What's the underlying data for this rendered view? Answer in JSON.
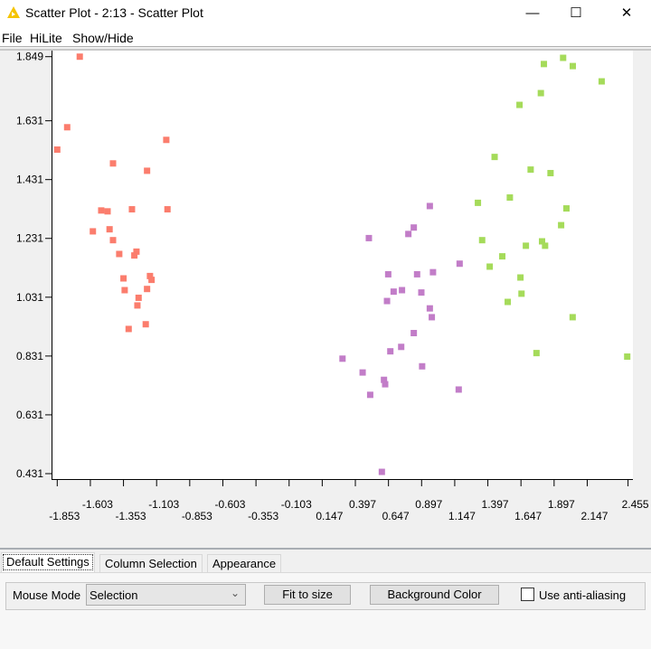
{
  "window": {
    "title": "Scatter Plot - 2:13 - Scatter Plot",
    "minimize_icon": "minimize-icon",
    "maximize_icon": "maximize-icon",
    "close_icon": "close-icon"
  },
  "menu": {
    "items": [
      "File",
      "HiLite",
      "Show/Hide"
    ]
  },
  "colors": {
    "class1": "#fb7d6d",
    "class2": "#c27dc8",
    "class3": "#a5db5a"
  },
  "chart_data": {
    "type": "scatter",
    "xlim": [
      -1.853,
      2.455
    ],
    "ylim": [
      0.431,
      1.849
    ],
    "grid": false,
    "x_ticks": [
      "-1.853",
      "-1.603",
      "-1.353",
      "-1.103",
      "-0.853",
      "-0.603",
      "-0.353",
      "-0.103",
      "0.147",
      "0.397",
      "0.647",
      "0.897",
      "1.147",
      "1.397",
      "1.647",
      "1.897",
      "2.147",
      "2.455"
    ],
    "y_ticks": [
      "1.849",
      "1.631",
      "1.431",
      "1.231",
      "1.031",
      "0.831",
      "0.631",
      "0.431"
    ],
    "series": [
      {
        "color": "#fb7d6d",
        "points": [
          [
            -1.683,
            1.849
          ],
          [
            -1.778,
            1.609
          ],
          [
            -1.853,
            1.533
          ],
          [
            -1.03,
            1.566
          ],
          [
            -1.432,
            1.486
          ],
          [
            -1.175,
            1.461
          ],
          [
            -1.521,
            1.326
          ],
          [
            -1.473,
            1.323
          ],
          [
            -1.289,
            1.33
          ],
          [
            -1.021,
            1.33
          ],
          [
            -1.584,
            1.255
          ],
          [
            -1.458,
            1.262
          ],
          [
            -1.432,
            1.225
          ],
          [
            -1.385,
            1.178
          ],
          [
            -1.255,
            1.186
          ],
          [
            -1.271,
            1.173
          ],
          [
            -1.353,
            1.095
          ],
          [
            -1.153,
            1.103
          ],
          [
            -1.141,
            1.09
          ],
          [
            -1.344,
            1.055
          ],
          [
            -1.175,
            1.059
          ],
          [
            -1.239,
            1.029
          ],
          [
            -1.248,
            1.003
          ],
          [
            -1.314,
            0.923
          ],
          [
            -1.185,
            0.939
          ]
        ]
      },
      {
        "color": "#c27dc8",
        "points": [
          [
            0.959,
            1.341
          ],
          [
            0.838,
            1.268
          ],
          [
            0.797,
            1.246
          ],
          [
            0.499,
            1.232
          ],
          [
            1.184,
            1.145
          ],
          [
            0.645,
            1.109
          ],
          [
            0.863,
            1.109
          ],
          [
            0.983,
            1.116
          ],
          [
            0.686,
            1.05
          ],
          [
            0.749,
            1.055
          ],
          [
            0.895,
            1.047
          ],
          [
            0.636,
            1.018
          ],
          [
            0.959,
            0.993
          ],
          [
            0.974,
            0.963
          ],
          [
            0.838,
            0.909
          ],
          [
            0.743,
            0.862
          ],
          [
            0.661,
            0.847
          ],
          [
            0.3,
            0.822
          ],
          [
            0.901,
            0.796
          ],
          [
            0.452,
            0.775
          ],
          [
            0.613,
            0.75
          ],
          [
            0.622,
            0.735
          ],
          [
            1.177,
            0.717
          ],
          [
            0.509,
            0.699
          ],
          [
            0.597,
            0.437
          ]
        ]
      },
      {
        "color": "#a5db5a",
        "points": [
          [
            1.965,
            1.845
          ],
          [
            1.82,
            1.824
          ],
          [
            2.038,
            1.817
          ],
          [
            2.256,
            1.765
          ],
          [
            1.797,
            1.725
          ],
          [
            1.636,
            1.685
          ],
          [
            1.448,
            1.508
          ],
          [
            1.72,
            1.465
          ],
          [
            1.87,
            1.453
          ],
          [
            1.563,
            1.37
          ],
          [
            1.322,
            1.352
          ],
          [
            1.99,
            1.333
          ],
          [
            1.95,
            1.276
          ],
          [
            1.354,
            1.225
          ],
          [
            1.684,
            1.206
          ],
          [
            1.806,
            1.221
          ],
          [
            1.829,
            1.206
          ],
          [
            1.506,
            1.17
          ],
          [
            1.411,
            1.135
          ],
          [
            1.643,
            1.098
          ],
          [
            1.651,
            1.043
          ],
          [
            1.547,
            1.015
          ],
          [
            2.037,
            0.963
          ],
          [
            1.764,
            0.841
          ],
          [
            2.449,
            0.829
          ]
        ]
      }
    ]
  },
  "tabs": [
    "Default Settings",
    "Column Selection",
    "Appearance"
  ],
  "controls": {
    "mouse_mode_label": "Mouse Mode",
    "mouse_mode_value": "Selection",
    "fit_button": "Fit to size",
    "background_button": "Background Color",
    "antialias_label": "Use anti-aliasing",
    "antialias_checked": false
  }
}
